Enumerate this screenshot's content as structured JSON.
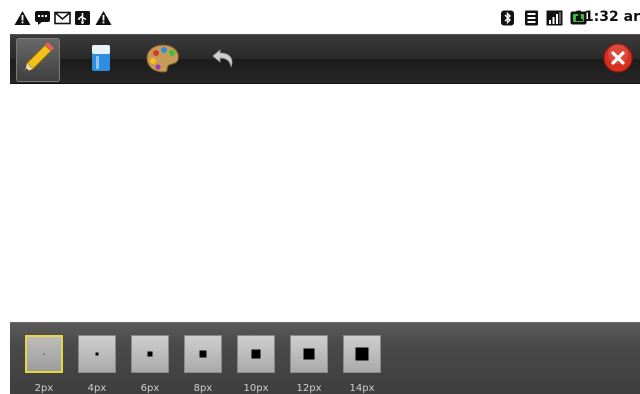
{
  "status_bar": {
    "left_icons": [
      "warning-icon",
      "chat-icon",
      "mail-icon",
      "usb-icon",
      "warning-icon"
    ],
    "right_icons": [
      "bluetooth-icon",
      "wifi-icon",
      "signal-icon",
      "battery-icon"
    ],
    "time": "11:32 ar"
  },
  "toolbar": {
    "tools": [
      {
        "name": "pencil-tool",
        "icon": "pencil-icon",
        "selected": true
      },
      {
        "name": "eraser-tool",
        "icon": "eraser-icon",
        "selected": false
      },
      {
        "name": "color-palette-tool",
        "icon": "palette-icon",
        "selected": false
      },
      {
        "name": "undo-tool",
        "icon": "undo-icon",
        "selected": false
      }
    ],
    "close_icon": "close-icon"
  },
  "brush_sizes": {
    "selected_index": 0,
    "items": [
      {
        "label": "2px",
        "size": 2
      },
      {
        "label": "4px",
        "size": 4
      },
      {
        "label": "6px",
        "size": 6
      },
      {
        "label": "8px",
        "size": 8
      },
      {
        "label": "10px",
        "size": 10
      },
      {
        "label": "12px",
        "size": 12
      },
      {
        "label": "14px",
        "size": 14
      }
    ]
  },
  "colors": {
    "selected_border": "#e8d640",
    "close_button": "#d63020"
  }
}
